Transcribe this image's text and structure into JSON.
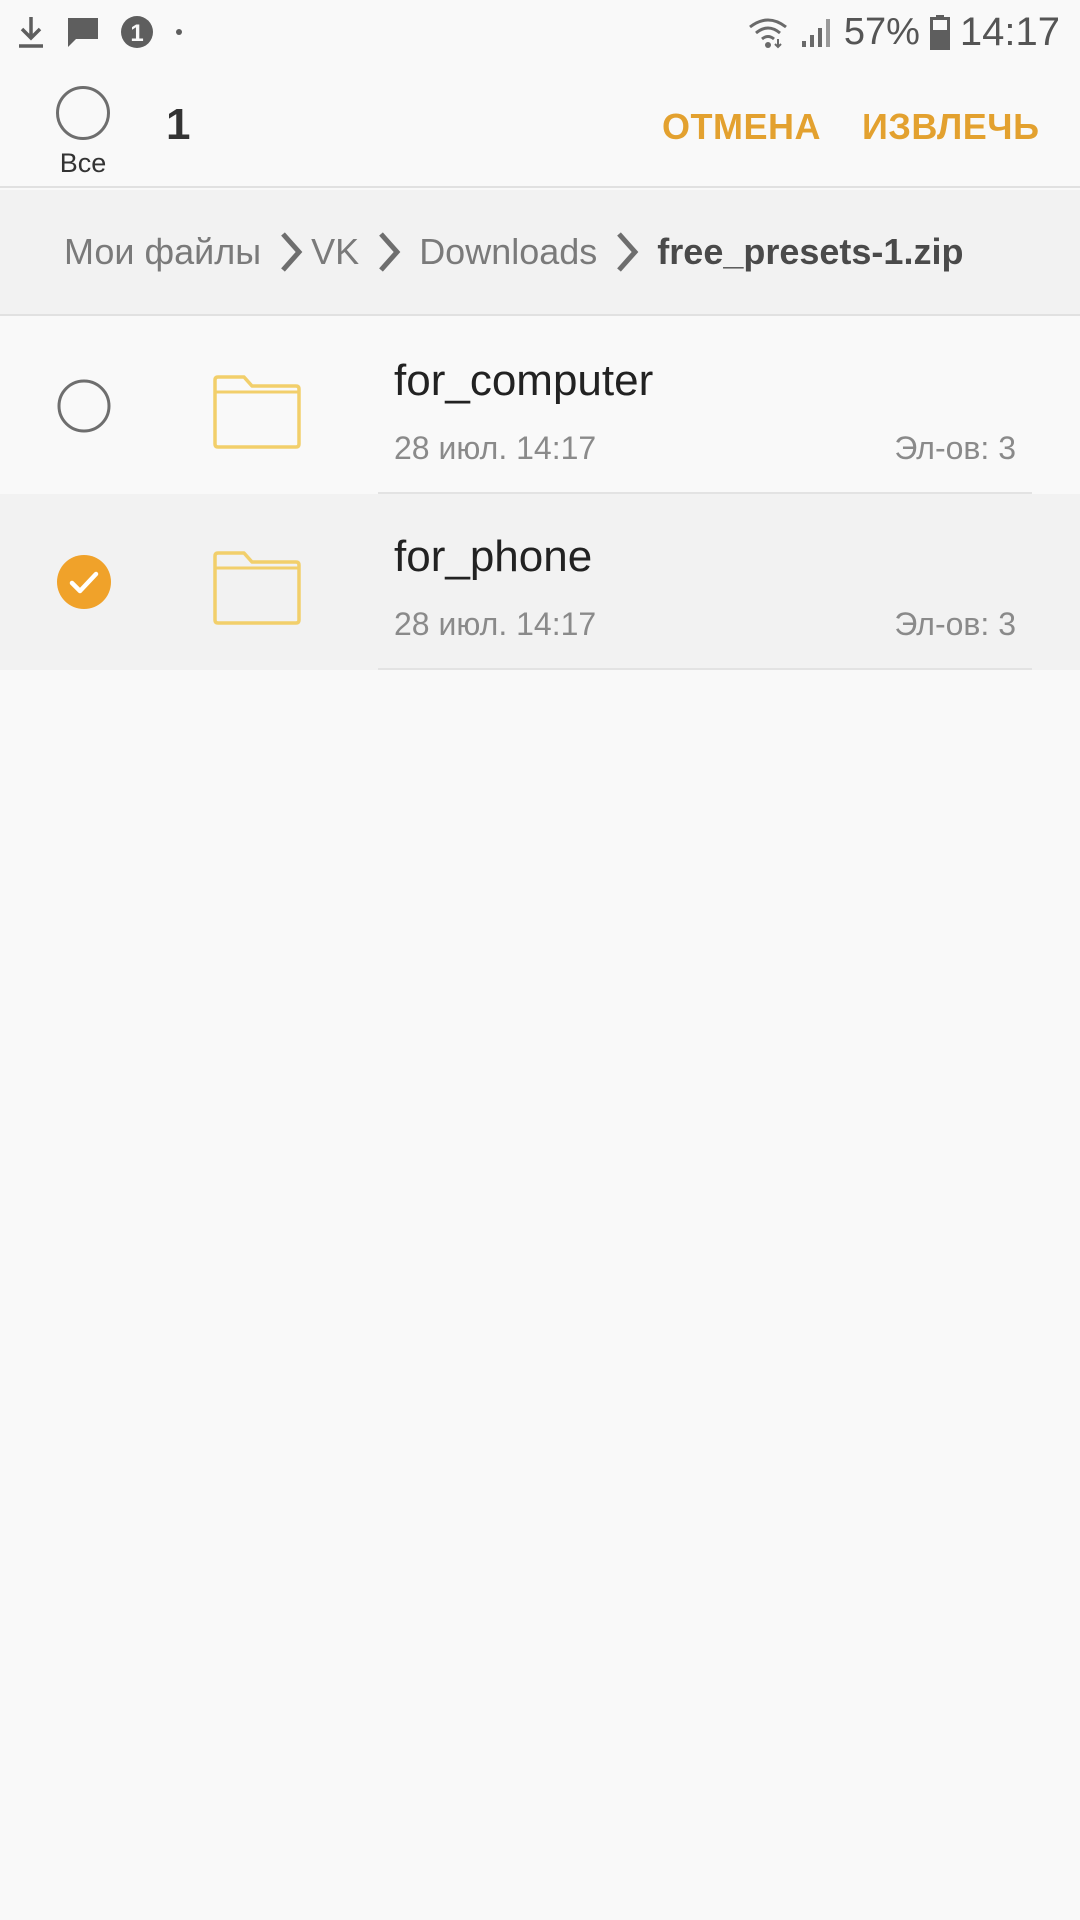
{
  "status_bar": {
    "battery": "57%",
    "time": "14:17",
    "notification_badge": "1",
    "icons": [
      "download-icon",
      "message-icon",
      "notification-badge-icon",
      "dot-icon",
      "wifi-icon",
      "signal-icon",
      "battery-icon"
    ]
  },
  "header": {
    "select_all_label": "Все",
    "selected_count": "1",
    "cancel_label": "ОТМЕНА",
    "extract_label": "ИЗВЛЕЧЬ"
  },
  "breadcrumb": {
    "items": [
      "Мои файлы",
      "VK",
      "Downloads",
      "free_presets-1.zip"
    ]
  },
  "files": [
    {
      "name": "for_computer",
      "date": "28 июл. 14:17",
      "count": "Эл-ов: 3",
      "selected": false
    },
    {
      "name": "for_phone",
      "date": "28 июл. 14:17",
      "count": "Эл-ов: 3",
      "selected": true
    }
  ],
  "colors": {
    "accent": "#e3a12f",
    "check": "#f0a22a",
    "folder_outline": "#f2cf6b",
    "background": "#f9f9f9"
  }
}
